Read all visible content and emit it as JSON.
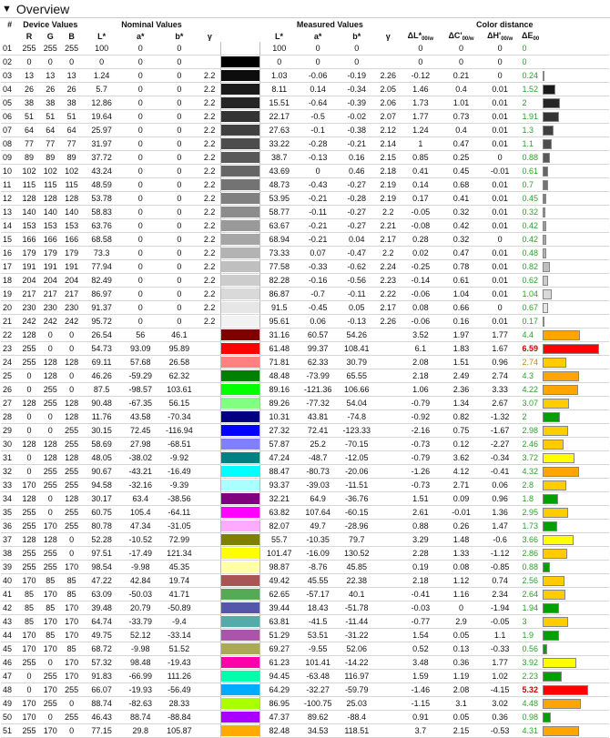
{
  "header": {
    "title": "Overview"
  },
  "columns": {
    "num": "#",
    "device": "Device Values",
    "nominal": "Nominal Values",
    "measured": "Measured Values",
    "colordist": "Color distance",
    "R": "R",
    "G": "G",
    "B": "B",
    "L": "L*",
    "a": "a*",
    "b": "b*",
    "gamma": "γ",
    "dL": "ΔL*",
    "dC": "ΔC'",
    "dH": "ΔH'",
    "dE": "ΔE",
    "sub00w": "00/w",
    "sub00": "00"
  },
  "rows": [
    [
      "01",
      "255",
      "255",
      "255",
      "100",
      "0",
      "0",
      "",
      "#ffffff",
      "100",
      "0",
      "0",
      "",
      "0",
      "0",
      "0",
      "0",
      "#ffffff",
      0,
      "g"
    ],
    [
      "02",
      "0",
      "0",
      "0",
      "0",
      "0",
      "0",
      "",
      "#000000",
      "0",
      "0",
      "0",
      "",
      "0",
      "0",
      "0",
      "0",
      "#000000",
      0,
      "g"
    ],
    [
      "03",
      "13",
      "13",
      "13",
      "1.24",
      "0",
      "0",
      "2.2",
      "#0d0d0d",
      "1.03",
      "-0.06",
      "-0.19",
      "2.26",
      "-0.12",
      "0.21",
      "0",
      "0.24",
      "#0d0d0d",
      0.24,
      "g"
    ],
    [
      "04",
      "26",
      "26",
      "26",
      "5.7",
      "0",
      "0",
      "2.2",
      "#1a1a1a",
      "8.11",
      "0.14",
      "-0.34",
      "2.05",
      "1.46",
      "0.4",
      "0.01",
      "1.52",
      "#1a1a1a",
      1.52,
      "g"
    ],
    [
      "05",
      "38",
      "38",
      "38",
      "12.86",
      "0",
      "0",
      "2.2",
      "#262626",
      "15.51",
      "-0.64",
      "-0.39",
      "2.06",
      "1.73",
      "1.01",
      "0.01",
      "2",
      "#262626",
      2,
      "g"
    ],
    [
      "06",
      "51",
      "51",
      "51",
      "19.64",
      "0",
      "0",
      "2.2",
      "#333333",
      "22.17",
      "-0.5",
      "-0.02",
      "2.07",
      "1.77",
      "0.73",
      "0.01",
      "1.91",
      "#333333",
      1.91,
      "g"
    ],
    [
      "07",
      "64",
      "64",
      "64",
      "25.97",
      "0",
      "0",
      "2.2",
      "#404040",
      "27.63",
      "-0.1",
      "-0.38",
      "2.12",
      "1.24",
      "0.4",
      "0.01",
      "1.3",
      "#404040",
      1.3,
      "g"
    ],
    [
      "08",
      "77",
      "77",
      "77",
      "31.97",
      "0",
      "0",
      "2.2",
      "#4d4d4d",
      "33.22",
      "-0.28",
      "-0.21",
      "2.14",
      "1",
      "0.47",
      "0.01",
      "1.1",
      "#4d4d4d",
      1.1,
      "g"
    ],
    [
      "09",
      "89",
      "89",
      "89",
      "37.72",
      "0",
      "0",
      "2.2",
      "#595959",
      "38.7",
      "-0.13",
      "0.16",
      "2.15",
      "0.85",
      "0.25",
      "0",
      "0.88",
      "#595959",
      0.88,
      "g"
    ],
    [
      "10",
      "102",
      "102",
      "102",
      "43.24",
      "0",
      "0",
      "2.2",
      "#666666",
      "43.69",
      "0",
      "0.46",
      "2.18",
      "0.41",
      "0.45",
      "-0.01",
      "0.61",
      "#666666",
      0.61,
      "g"
    ],
    [
      "11",
      "115",
      "115",
      "115",
      "48.59",
      "0",
      "0",
      "2.2",
      "#737373",
      "48.73",
      "-0.43",
      "-0.27",
      "2.19",
      "0.14",
      "0.68",
      "0.01",
      "0.7",
      "#737373",
      0.7,
      "g"
    ],
    [
      "12",
      "128",
      "128",
      "128",
      "53.78",
      "0",
      "0",
      "2.2",
      "#808080",
      "53.95",
      "-0.21",
      "-0.28",
      "2.19",
      "0.17",
      "0.41",
      "0.01",
      "0.45",
      "#808080",
      0.45,
      "g"
    ],
    [
      "13",
      "140",
      "140",
      "140",
      "58.83",
      "0",
      "0",
      "2.2",
      "#8c8c8c",
      "58.77",
      "-0.11",
      "-0.27",
      "2.2",
      "-0.05",
      "0.32",
      "0.01",
      "0.32",
      "#8c8c8c",
      0.32,
      "g"
    ],
    [
      "14",
      "153",
      "153",
      "153",
      "63.76",
      "0",
      "0",
      "2.2",
      "#999999",
      "63.67",
      "-0.21",
      "-0.27",
      "2.21",
      "-0.08",
      "0.42",
      "0.01",
      "0.42",
      "#999999",
      0.42,
      "g"
    ],
    [
      "15",
      "166",
      "166",
      "166",
      "68.58",
      "0",
      "0",
      "2.2",
      "#a6a6a6",
      "68.94",
      "-0.21",
      "0.04",
      "2.17",
      "0.28",
      "0.32",
      "0",
      "0.42",
      "#a6a6a6",
      0.42,
      "g"
    ],
    [
      "16",
      "179",
      "179",
      "179",
      "73.3",
      "0",
      "0",
      "2.2",
      "#b3b3b3",
      "73.33",
      "0.07",
      "-0.47",
      "2.2",
      "0.02",
      "0.47",
      "0.01",
      "0.48",
      "#b3b3b3",
      0.48,
      "g"
    ],
    [
      "17",
      "191",
      "191",
      "191",
      "77.94",
      "0",
      "0",
      "2.2",
      "#bfbfbf",
      "77.58",
      "-0.33",
      "-0.62",
      "2.24",
      "-0.25",
      "0.78",
      "0.01",
      "0.82",
      "#bfbfbf",
      0.82,
      "g"
    ],
    [
      "18",
      "204",
      "204",
      "204",
      "82.49",
      "0",
      "0",
      "2.2",
      "#cccccc",
      "82.28",
      "-0.16",
      "-0.56",
      "2.23",
      "-0.14",
      "0.61",
      "0.01",
      "0.62",
      "#cccccc",
      0.62,
      "g"
    ],
    [
      "19",
      "217",
      "217",
      "217",
      "86.97",
      "0",
      "0",
      "2.2",
      "#d9d9d9",
      "86.87",
      "-0.7",
      "-0.11",
      "2.22",
      "-0.06",
      "1.04",
      "0.01",
      "1.04",
      "#d9d9d9",
      1.04,
      "g"
    ],
    [
      "20",
      "230",
      "230",
      "230",
      "91.37",
      "0",
      "0",
      "2.2",
      "#e6e6e6",
      "91.5",
      "-0.45",
      "0.05",
      "2.17",
      "0.08",
      "0.66",
      "0",
      "0.67",
      "#e6e6e6",
      0.67,
      "g"
    ],
    [
      "21",
      "242",
      "242",
      "242",
      "95.72",
      "0",
      "0",
      "2.2",
      "#f2f2f2",
      "95.61",
      "0.06",
      "-0.13",
      "2.26",
      "-0.06",
      "0.16",
      "0.01",
      "0.17",
      "#f2f2f2",
      0.17,
      "g"
    ],
    [
      "22",
      "128",
      "0",
      "0",
      "26.54",
      "56",
      "46.1",
      "",
      "#800000",
      "31.16",
      "60.57",
      "54.26",
      "",
      "3.52",
      "1.97",
      "1.77",
      "4.4",
      "#ffa500",
      4.4,
      "g"
    ],
    [
      "23",
      "255",
      "0",
      "0",
      "54.73",
      "93.09",
      "95.89",
      "",
      "#ff0000",
      "61.48",
      "99.37",
      "108.41",
      "",
      "6.1",
      "1.83",
      "1.67",
      "6.59",
      "#ff0000",
      6.59,
      "r"
    ],
    [
      "24",
      "255",
      "128",
      "128",
      "69.11",
      "57.68",
      "26.58",
      "",
      "#ff8080",
      "71.81",
      "62.33",
      "30.79",
      "",
      "2.08",
      "1.51",
      "0.96",
      "2.74",
      "#ffcc00",
      2.74,
      "o"
    ],
    [
      "25",
      "0",
      "128",
      "0",
      "46.26",
      "-59.29",
      "62.32",
      "",
      "#008000",
      "48.48",
      "-73.99",
      "65.55",
      "",
      "2.18",
      "2.49",
      "2.74",
      "4.3",
      "#ffa500",
      4.3,
      "g"
    ],
    [
      "26",
      "0",
      "255",
      "0",
      "87.5",
      "-98.57",
      "103.61",
      "",
      "#00ff00",
      "89.16",
      "-121.36",
      "106.66",
      "",
      "1.06",
      "2.36",
      "3.33",
      "4.22",
      "#ffa500",
      4.22,
      "g"
    ],
    [
      "27",
      "128",
      "255",
      "128",
      "90.48",
      "-67.35",
      "56.15",
      "",
      "#80ff80",
      "89.26",
      "-77.32",
      "54.04",
      "",
      "-0.79",
      "1.34",
      "2.67",
      "3.07",
      "#ffcc00",
      3.07,
      "g"
    ],
    [
      "28",
      "0",
      "0",
      "128",
      "11.76",
      "43.58",
      "-70.34",
      "",
      "#000080",
      "10.31",
      "43.81",
      "-74.8",
      "",
      "-0.92",
      "0.82",
      "-1.32",
      "2",
      "#00a000",
      2,
      "g"
    ],
    [
      "29",
      "0",
      "0",
      "255",
      "30.15",
      "72.45",
      "-116.94",
      "",
      "#0000ff",
      "27.32",
      "72.41",
      "-123.33",
      "",
      "-2.16",
      "0.75",
      "-1.67",
      "2.98",
      "#ffcc00",
      2.98,
      "g"
    ],
    [
      "30",
      "128",
      "128",
      "255",
      "58.69",
      "27.98",
      "-68.51",
      "",
      "#8080ff",
      "57.87",
      "25.2",
      "-70.15",
      "",
      "-0.73",
      "0.12",
      "-2.27",
      "2.46",
      "#ffcc00",
      2.46,
      "g"
    ],
    [
      "31",
      "0",
      "128",
      "128",
      "48.05",
      "-38.02",
      "-9.92",
      "",
      "#008080",
      "47.24",
      "-48.7",
      "-12.05",
      "",
      "-0.79",
      "3.62",
      "-0.34",
      "3.72",
      "#ffff00",
      3.72,
      "g"
    ],
    [
      "32",
      "0",
      "255",
      "255",
      "90.67",
      "-43.21",
      "-16.49",
      "",
      "#00ffff",
      "88.47",
      "-80.73",
      "-20.06",
      "",
      "-1.26",
      "4.12",
      "-0.41",
      "4.32",
      "#ffa500",
      4.32,
      "g"
    ],
    [
      "33",
      "170",
      "255",
      "255",
      "94.58",
      "-32.16",
      "-9.39",
      "",
      "#aaffff",
      "93.37",
      "-39.03",
      "-11.51",
      "",
      "-0.73",
      "2.71",
      "0.06",
      "2.8",
      "#ffcc00",
      2.8,
      "g"
    ],
    [
      "34",
      "128",
      "0",
      "128",
      "30.17",
      "63.4",
      "-38.56",
      "",
      "#800080",
      "32.21",
      "64.9",
      "-36.76",
      "",
      "1.51",
      "0.09",
      "0.96",
      "1.8",
      "#00a000",
      1.8,
      "g"
    ],
    [
      "35",
      "255",
      "0",
      "255",
      "60.75",
      "105.4",
      "-64.11",
      "",
      "#ff00ff",
      "63.82",
      "107.64",
      "-60.15",
      "",
      "2.61",
      "-0.01",
      "1.36",
      "2.95",
      "#ffcc00",
      2.95,
      "g"
    ],
    [
      "36",
      "255",
      "170",
      "255",
      "80.78",
      "47.34",
      "-31.05",
      "",
      "#ffaaff",
      "82.07",
      "49.7",
      "-28.96",
      "",
      "0.88",
      "0.26",
      "1.47",
      "1.73",
      "#00a000",
      1.73,
      "g"
    ],
    [
      "37",
      "128",
      "128",
      "0",
      "52.28",
      "-10.52",
      "72.99",
      "",
      "#808000",
      "55.7",
      "-10.35",
      "79.7",
      "",
      "3.29",
      "1.48",
      "-0.6",
      "3.66",
      "#ffff00",
      3.66,
      "g"
    ],
    [
      "38",
      "255",
      "255",
      "0",
      "97.51",
      "-17.49",
      "121.34",
      "",
      "#ffff00",
      "101.47",
      "-16.09",
      "130.52",
      "",
      "2.28",
      "1.33",
      "-1.12",
      "2.86",
      "#ffcc00",
      2.86,
      "g"
    ],
    [
      "39",
      "255",
      "255",
      "170",
      "98.54",
      "-9.98",
      "45.35",
      "",
      "#ffffaa",
      "98.87",
      "-8.76",
      "45.85",
      "",
      "0.19",
      "0.08",
      "-0.85",
      "0.88",
      "#00a000",
      0.88,
      "g"
    ],
    [
      "40",
      "170",
      "85",
      "85",
      "47.22",
      "42.84",
      "19.74",
      "",
      "#aa5555",
      "49.42",
      "45.55",
      "22.38",
      "",
      "2.18",
      "1.12",
      "0.74",
      "2.56",
      "#ffcc00",
      2.56,
      "g"
    ],
    [
      "41",
      "85",
      "170",
      "85",
      "63.09",
      "-50.03",
      "41.71",
      "",
      "#55aa55",
      "62.65",
      "-57.17",
      "40.1",
      "",
      "-0.41",
      "1.16",
      "2.34",
      "2.64",
      "#ffcc00",
      2.64,
      "g"
    ],
    [
      "42",
      "85",
      "85",
      "170",
      "39.48",
      "20.79",
      "-50.89",
      "",
      "#5555aa",
      "39.44",
      "18.43",
      "-51.78",
      "",
      "-0.03",
      "0",
      "-1.94",
      "1.94",
      "#00a000",
      1.94,
      "g"
    ],
    [
      "43",
      "85",
      "170",
      "170",
      "64.74",
      "-33.79",
      "-9.4",
      "",
      "#55aaaa",
      "63.81",
      "-41.5",
      "-11.44",
      "",
      "-0.77",
      "2.9",
      "-0.05",
      "3",
      "#ffcc00",
      3,
      "g"
    ],
    [
      "44",
      "170",
      "85",
      "170",
      "49.75",
      "52.12",
      "-33.14",
      "",
      "#aa55aa",
      "51.29",
      "53.51",
      "-31.22",
      "",
      "1.54",
      "0.05",
      "1.1",
      "1.9",
      "#00a000",
      1.9,
      "g"
    ],
    [
      "45",
      "170",
      "170",
      "85",
      "68.72",
      "-9.98",
      "51.52",
      "",
      "#aaaa55",
      "69.27",
      "-9.55",
      "52.06",
      "",
      "0.52",
      "0.13",
      "-0.33",
      "0.56",
      "#00a000",
      0.56,
      "g"
    ],
    [
      "46",
      "255",
      "0",
      "170",
      "57.32",
      "98.48",
      "-19.43",
      "",
      "#ff00aa",
      "61.23",
      "101.41",
      "-14.22",
      "",
      "3.48",
      "0.36",
      "1.77",
      "3.92",
      "#ffff00",
      3.92,
      "g"
    ],
    [
      "47",
      "0",
      "255",
      "170",
      "91.83",
      "-66.99",
      "111.26",
      "",
      "#00ffaa",
      "94.45",
      "-63.48",
      "116.97",
      "",
      "1.59",
      "1.19",
      "1.02",
      "2.23",
      "#00a000",
      2.23,
      "g"
    ],
    [
      "48",
      "0",
      "170",
      "255",
      "66.07",
      "-19.93",
      "-56.49",
      "",
      "#00aaff",
      "64.29",
      "-32.27",
      "-59.79",
      "",
      "-1.46",
      "2.08",
      "-4.15",
      "5.32",
      "#ff0000",
      5.32,
      "r"
    ],
    [
      "49",
      "170",
      "255",
      "0",
      "88.74",
      "-82.63",
      "28.33",
      "",
      "#aaff00",
      "86.95",
      "-100.75",
      "25.03",
      "",
      "-1.15",
      "3.1",
      "3.02",
      "4.48",
      "#ffa500",
      4.48,
      "g"
    ],
    [
      "50",
      "170",
      "0",
      "255",
      "46.43",
      "88.74",
      "-88.84",
      "",
      "#aa00ff",
      "47.37",
      "89.62",
      "-88.4",
      "",
      "0.91",
      "0.05",
      "0.36",
      "0.98",
      "#00a000",
      0.98,
      "g"
    ],
    [
      "51",
      "255",
      "170",
      "0",
      "77.15",
      "29.8",
      "105.87",
      "",
      "#ffaa00",
      "82.48",
      "34.53",
      "118.51",
      "",
      "3.7",
      "2.15",
      "-0.53",
      "4.31",
      "#ffa500",
      4.31,
      "g"
    ]
  ]
}
